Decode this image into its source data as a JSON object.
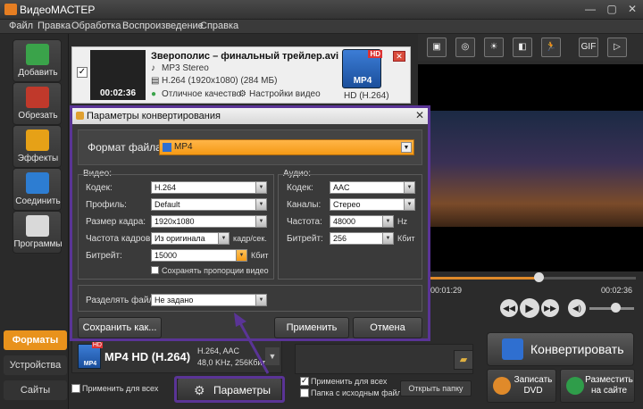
{
  "app": {
    "title": "ВидеоМАСТЕР"
  },
  "menu": [
    "Файл",
    "Правка",
    "Обработка",
    "Воспроизведение",
    "Справка"
  ],
  "sidebar": {
    "items": [
      {
        "label": "Добавить",
        "color": "#3aa34a"
      },
      {
        "label": "Обрезать",
        "color": "#c0392b"
      },
      {
        "label": "Эффекты",
        "color": "#e6a117"
      },
      {
        "label": "Соединить",
        "color": "#2d7dd2"
      },
      {
        "label": "Программы",
        "color": "#d9d9d9"
      }
    ],
    "tabs": [
      "Форматы",
      "Устройства",
      "Сайты"
    ],
    "active_tab_color": "#e8921c"
  },
  "file": {
    "name": "Зверополис – финальный трейлер.avi",
    "audio": "MP3 Stereo",
    "video": "H.264 (1920x1080) (284 МБ)",
    "duration": "00:02:36",
    "quality": "Отличное качество",
    "settings": "Настройки видео",
    "badge": "MP4",
    "badge_hd": "HD",
    "codec": "HD (H.264)",
    "checked_mark": "✓"
  },
  "toolbar": [
    "▣",
    "◎",
    "☀",
    "◧",
    "🏃",
    "GIF",
    "▷"
  ],
  "player": {
    "time_current": "00:01:29",
    "time_total": "00:02:36",
    "progress": 0.53
  },
  "dialog": {
    "title": "Параметры конвертирования",
    "format_label": "Формат файла:",
    "format_value": "MP4",
    "video_group": "Видео:",
    "audio_group": "Аудио:",
    "video": {
      "codec_label": "Кодек:",
      "codec": "H.264",
      "profile_label": "Профиль:",
      "profile": "Default",
      "size_label": "Размер кадра:",
      "size": "1920x1080",
      "fps_label": "Частота кадров:",
      "fps": "Из оригинала",
      "fps_unit": "кадр/сек.",
      "bitrate_label": "Битрейт:",
      "bitrate": "15000",
      "bitrate_unit": "Кбит",
      "keep_ratio": "Сохранять пропорции видео"
    },
    "audio": {
      "codec_label": "Кодек:",
      "codec": "AAC",
      "channels_label": "Каналы:",
      "channels": "Стерео",
      "freq_label": "Частота:",
      "freq": "48000",
      "freq_unit": "Hz",
      "bitrate_label": "Битрейт:",
      "bitrate": "256",
      "bitrate_unit": "Кбит"
    },
    "split_label": "Разделять файл:",
    "split_value": "Не задано",
    "save_as": "Сохранить как...",
    "apply": "Применить",
    "cancel": "Отмена"
  },
  "bottom": {
    "format_name": "MP4 HD (H.264)",
    "format_info1": "H.264, AAC",
    "format_info2": "48,0 KHz, 256Кбит",
    "icon_badge": "MP4",
    "icon_hd": "HD",
    "apply_all": "Применить для всех",
    "apply_all2": "Применить для всех",
    "same_folder": "Папка с исходным файлом",
    "open_folder": "Открыть папку",
    "params": "Параметры",
    "convert": "Конвертировать",
    "dvd": "Записать DVD",
    "publish": "Разместить на сайте"
  }
}
